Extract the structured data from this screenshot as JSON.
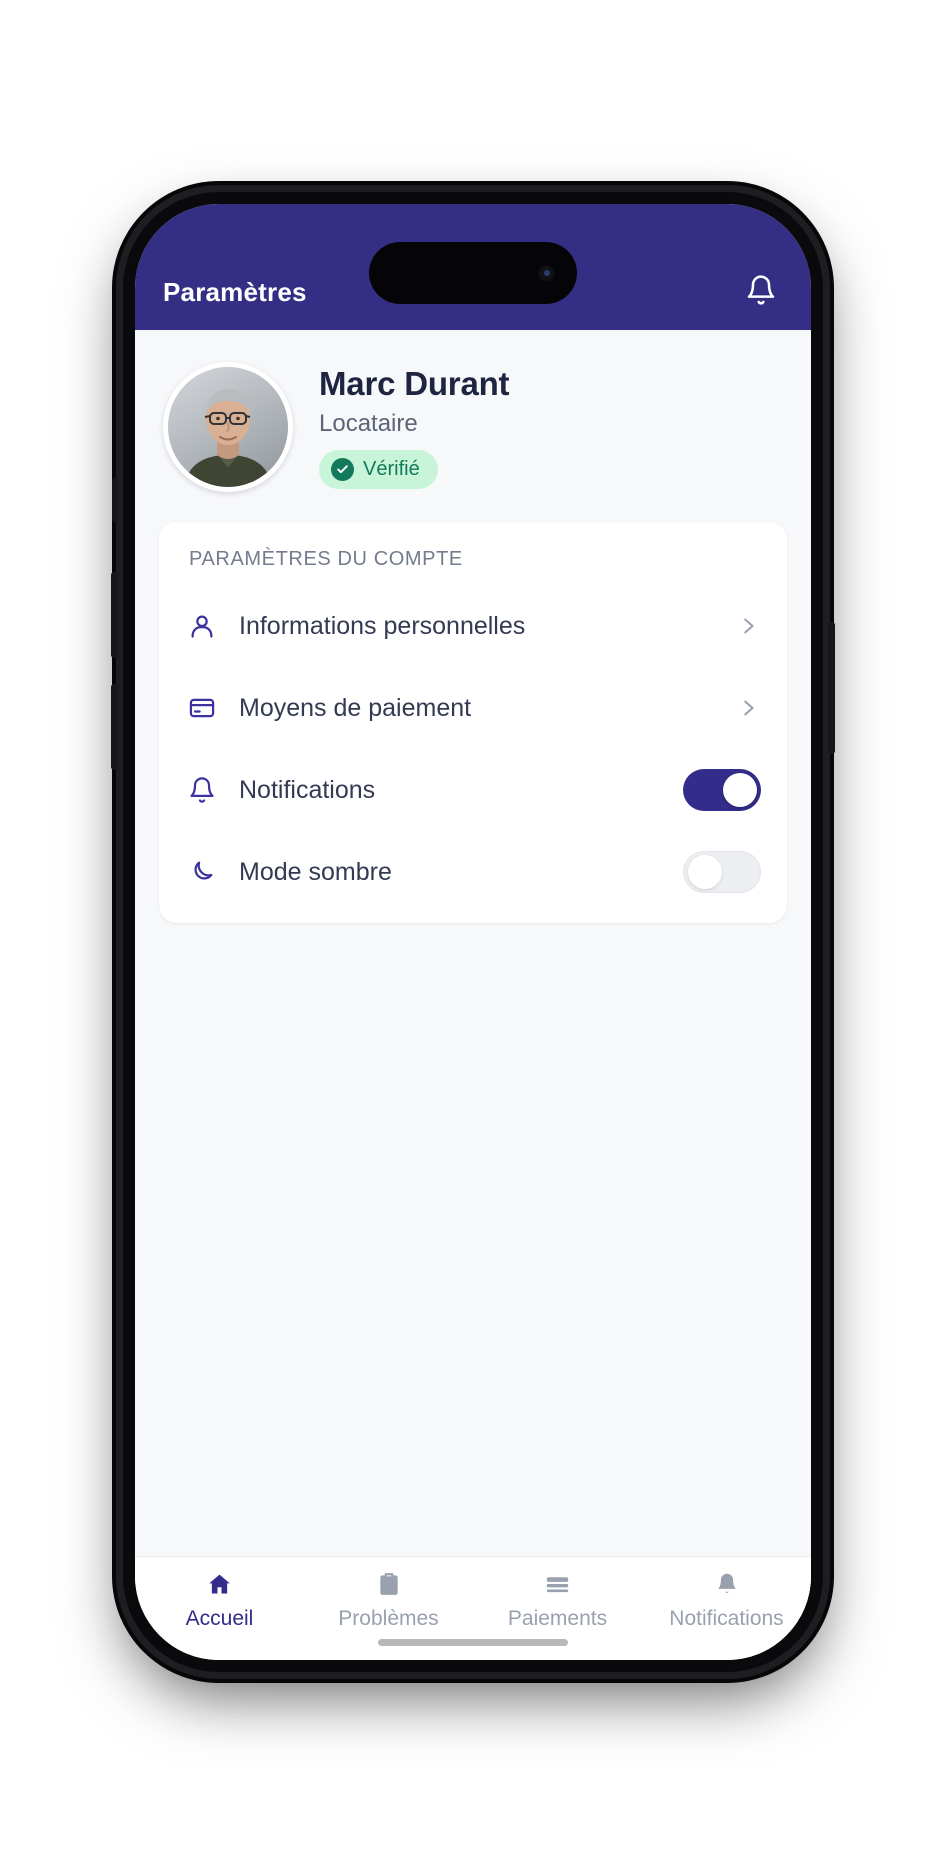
{
  "theme": {
    "primary": "#342F84",
    "accent_toggle_on": "#332C8A",
    "screen_bg": "#F7F8FA",
    "card_bg": "#FFFFFF",
    "text_primary": "#333A52",
    "text_muted": "#737B8D",
    "badge_bg": "#C8F5DA",
    "badge_fg": "#12795A",
    "nav_inactive": "#9AA1AE"
  },
  "header": {
    "title": "Paramètres",
    "notification_icon": "bell-icon"
  },
  "profile": {
    "name": "Marc Durant",
    "role": "Locataire",
    "avatar_icon": "avatar-photo",
    "badge": {
      "label": "Vérifié",
      "icon": "check-circle-icon"
    }
  },
  "settings_card": {
    "section_title": "PARAMÈTRES DU COMPTE",
    "rows": [
      {
        "label": "Informations personnelles",
        "icon": "user-icon",
        "control": "chevron",
        "chevron_icon": "chevron-right-icon"
      },
      {
        "label": "Moyens de paiement",
        "icon": "credit-card-icon",
        "control": "chevron",
        "chevron_icon": "chevron-right-icon"
      },
      {
        "label": "Notifications",
        "icon": "bell-icon",
        "control": "toggle",
        "toggle_state": "on"
      },
      {
        "label": "Mode sombre",
        "icon": "moon-icon",
        "control": "toggle",
        "toggle_state": "off"
      }
    ]
  },
  "bottom_nav": {
    "active_index": 0,
    "items": [
      {
        "label": "Accueil",
        "icon": "home-icon"
      },
      {
        "label": "Problèmes",
        "icon": "clipboard-icon"
      },
      {
        "label": "Paiements",
        "icon": "card-icon"
      },
      {
        "label": "Notifications",
        "icon": "bell-icon"
      }
    ]
  }
}
